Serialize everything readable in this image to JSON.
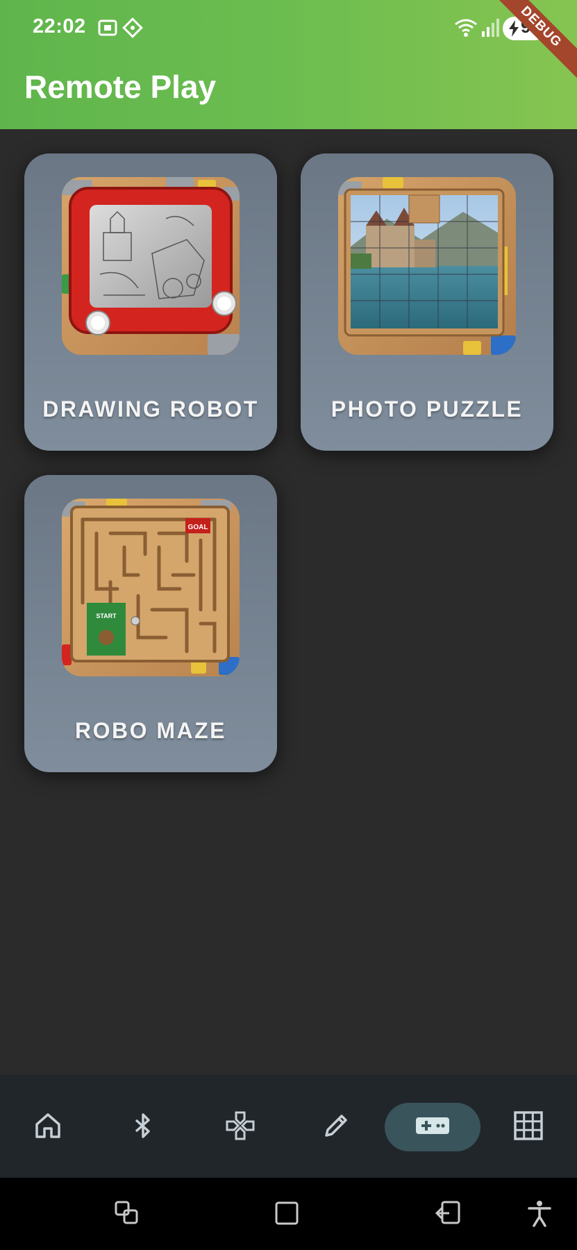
{
  "status_bar": {
    "time": "22:02",
    "battery": "91",
    "icons": [
      "screenshot-icon",
      "cast-icon",
      "wifi-icon",
      "signal-icon",
      "battery-charging-icon"
    ]
  },
  "app_bar": {
    "title": "Remote Play",
    "debug_banner": "DEBUG",
    "gradient": [
      "#5fb54c",
      "#86c451"
    ]
  },
  "games": [
    {
      "label": "DRAWING ROBOT",
      "icon": "drawing-robot-thumbnail"
    },
    {
      "label": "PHOTO PUZZLE",
      "icon": "photo-puzzle-thumbnail"
    },
    {
      "label": "ROBO MAZE",
      "icon": "robo-maze-thumbnail"
    }
  ],
  "maze_labels": {
    "goal": "GOAL",
    "start": "START"
  },
  "bottom_nav": {
    "items": [
      {
        "icon": "home-icon"
      },
      {
        "icon": "bluetooth-icon"
      },
      {
        "icon": "dpad-icon"
      },
      {
        "icon": "pencil-icon"
      },
      {
        "icon": "gamepad-icon",
        "selected": true
      },
      {
        "icon": "grid-icon"
      }
    ],
    "selected_color": "#39545a"
  },
  "system_nav": {
    "items": [
      {
        "icon": "recent-apps-icon"
      },
      {
        "icon": "home-square-icon"
      },
      {
        "icon": "back-icon"
      },
      {
        "icon": "accessibility-icon"
      }
    ]
  }
}
